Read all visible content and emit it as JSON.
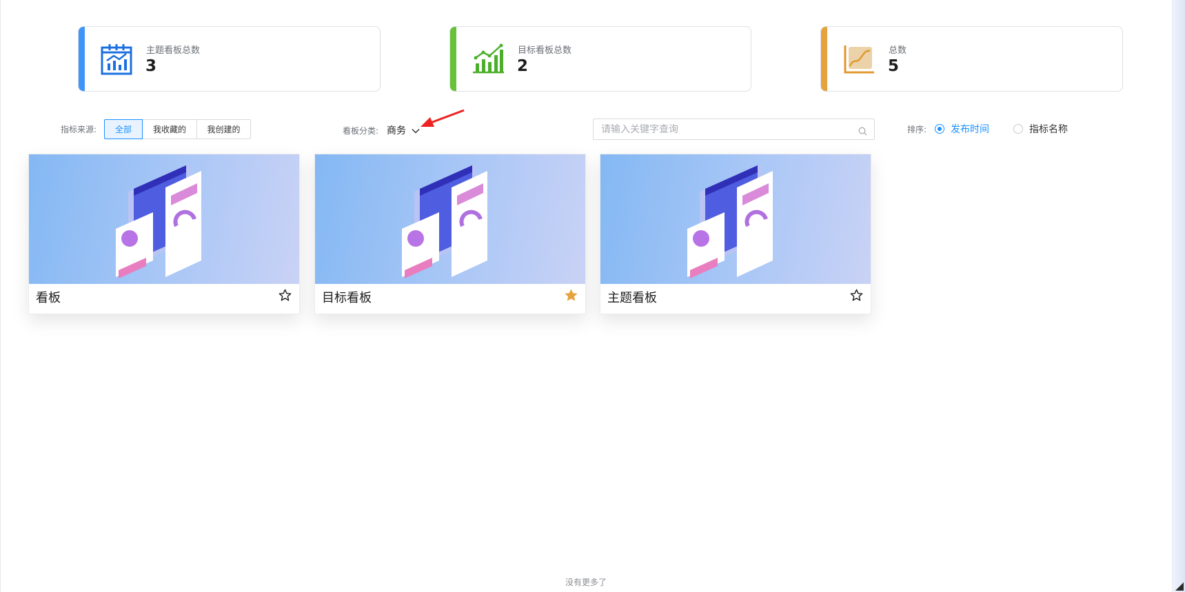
{
  "stats": [
    {
      "label": "主题看板总数",
      "value": "3",
      "color": "#3f95f7",
      "icon": "calendar-chart-icon"
    },
    {
      "label": "目标看板总数",
      "value": "2",
      "color": "#67c23a",
      "icon": "bar-trend-icon"
    },
    {
      "label": "总数",
      "value": "5",
      "color": "#e6a23c",
      "icon": "line-chart-icon"
    }
  ],
  "filters": {
    "source_label": "指标来源:",
    "source_options": [
      "全部",
      "我收藏的",
      "我创建的"
    ],
    "source_selected": "全部",
    "category_label": "看板分类:",
    "category_value": "商务",
    "search_placeholder": "请输入关键字查询",
    "search_value": "",
    "sort_label": "排序:",
    "sort_options": [
      "发布时间",
      "指标名称"
    ],
    "sort_selected": "发布时间"
  },
  "boards": [
    {
      "title": "看板",
      "starred": false
    },
    {
      "title": "目标看板",
      "starred": true
    },
    {
      "title": "主题看板",
      "starred": false
    }
  ],
  "footer": {
    "text": "没有更多了"
  },
  "colors": {
    "accent": "#1890ff",
    "star_active": "#e6a23c",
    "annotation_arrow": "#ee2222"
  }
}
